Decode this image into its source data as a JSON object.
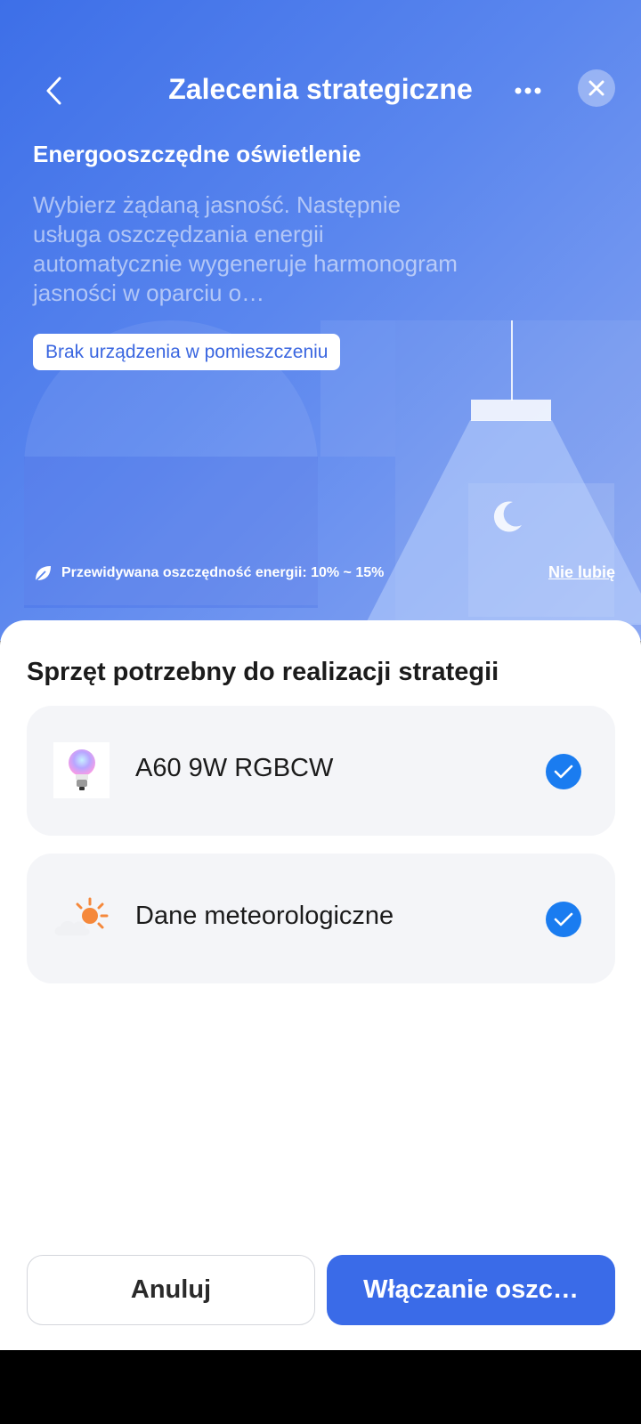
{
  "header": {
    "title": "Zalecenia strategiczne",
    "back_icon": "chevron-left-icon",
    "more_icon": "more-horizontal-icon",
    "close_icon": "close-icon"
  },
  "hero": {
    "title": "Energooszczędne oświetlenie",
    "description": "Wybierz żądaną jasność. Następnie usługa oszczędzania energii automatycznie wygeneruje harmonogram jasności w oparciu o…",
    "room_label": "Brak urządzenia w pomieszczeniu",
    "savings_text": "Przewidywana oszczędność energii: 10% ~ 15%",
    "dislike_label": "Nie lubię"
  },
  "sheet": {
    "title": "Sprzęt potrzebny do realizacji strategii",
    "devices": [
      {
        "name": "A60 9W RGBCW",
        "icon": "bulb-icon",
        "checked": true
      },
      {
        "name": "Dane meteorologiczne",
        "icon": "weather-icon",
        "checked": true
      }
    ]
  },
  "buttons": {
    "cancel": "Anuluj",
    "enable": "Włączanie oszc…"
  },
  "colors": {
    "accent": "#3a6be8",
    "check": "#1a7cf0",
    "card_bg": "#f4f5f8"
  }
}
